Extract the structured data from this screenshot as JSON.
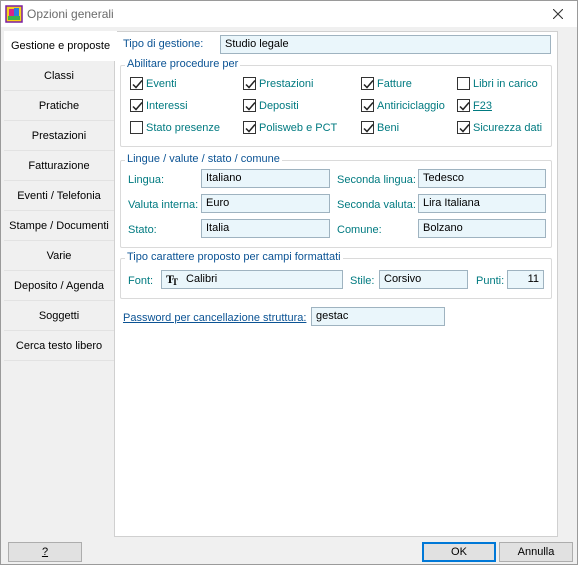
{
  "window": {
    "title": "Opzioni generali"
  },
  "sidebar": {
    "items": [
      {
        "label": "Gestione e proposte",
        "active": true
      },
      {
        "label": "Classi"
      },
      {
        "label": "Pratiche"
      },
      {
        "label": "Prestazioni"
      },
      {
        "label": "Fatturazione"
      },
      {
        "label": "Eventi / Telefonia"
      },
      {
        "label": "Stampe / Documenti"
      },
      {
        "label": "Varie"
      },
      {
        "label": "Deposito / Agenda"
      },
      {
        "label": "Soggetti"
      },
      {
        "label": "Cerca testo libero"
      }
    ]
  },
  "gestione": {
    "label": "Tipo di gestione:",
    "value": "Studio legale"
  },
  "procedure": {
    "title": "Abilitare procedure per",
    "items": [
      {
        "label": "Eventi",
        "checked": true
      },
      {
        "label": "Prestazioni",
        "checked": true
      },
      {
        "label": "Fatture",
        "checked": true
      },
      {
        "label": "Libri in carico",
        "checked": false
      },
      {
        "label": "Interessi",
        "checked": true
      },
      {
        "label": "Depositi",
        "checked": true
      },
      {
        "label": "Antiriciclaggio",
        "checked": true
      },
      {
        "label": "F23",
        "checked": true
      },
      {
        "label": "Stato presenze",
        "checked": false
      },
      {
        "label": "Polisweb e PCT",
        "checked": true
      },
      {
        "label": "Beni",
        "checked": true
      },
      {
        "label": "Sicurezza dati",
        "checked": true
      }
    ]
  },
  "lingue": {
    "title": "Lingue / valute / stato / comune",
    "lingua_label": "Lingua:",
    "lingua_value": "Italiano",
    "seconda_lingua_label": "Seconda lingua:",
    "seconda_lingua_value": "Tedesco",
    "valuta_label": "Valuta interna:",
    "valuta_value": "Euro",
    "seconda_valuta_label": "Seconda valuta:",
    "seconda_valuta_value": "Lira Italiana",
    "stato_label": "Stato:",
    "stato_value": "Italia",
    "comune_label": "Comune:",
    "comune_value": "Bolzano"
  },
  "carattere": {
    "title": "Tipo carattere proposto per campi formattati",
    "font_label": "Font:",
    "font_value": "Calibri",
    "stile_label": "Stile:",
    "stile_value": "Corsivo",
    "punti_label": "Punti:",
    "punti_value": "11"
  },
  "password": {
    "label": "Password per cancellazione struttura:",
    "value": "gestac"
  },
  "buttons": {
    "help": "?",
    "ok": "OK",
    "cancel": "Annulla"
  }
}
